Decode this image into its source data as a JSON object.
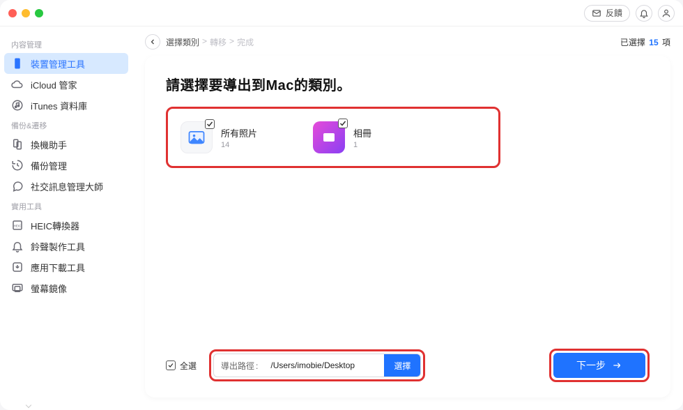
{
  "titlebar": {
    "feedback_label": "反饋"
  },
  "sidebar": {
    "sections": [
      {
        "header": "内容管理",
        "items": [
          {
            "label": "裝置管理工具",
            "icon": "phone-icon",
            "active": true
          },
          {
            "label": "iCloud 管家",
            "icon": "cloud-icon"
          },
          {
            "label": "iTunes 資料庫",
            "icon": "music-note-icon"
          }
        ]
      },
      {
        "header": "備份&遷移",
        "items": [
          {
            "label": "換機助手",
            "icon": "phone-swap-icon"
          },
          {
            "label": "備份管理",
            "icon": "clock-refresh-icon"
          },
          {
            "label": "社交訊息管理大師",
            "icon": "chat-bubble-icon"
          }
        ]
      },
      {
        "header": "實用工具",
        "items": [
          {
            "label": "HEIC轉換器",
            "icon": "heic-icon"
          },
          {
            "label": "鈴聲製作工具",
            "icon": "bell-icon"
          },
          {
            "label": "應用下載工具",
            "icon": "app-download-icon"
          },
          {
            "label": "螢幕鏡像",
            "icon": "screen-mirror-icon"
          }
        ]
      }
    ]
  },
  "breadcrumb": {
    "items": [
      "選擇類別",
      "轉移",
      "完成"
    ],
    "current_index": 0
  },
  "status": {
    "prefix": "已選擇",
    "count": "15",
    "suffix": "項"
  },
  "main": {
    "title": "請選擇要導出到Mac的類別。",
    "categories": [
      {
        "name": "所有照片",
        "count": "14",
        "kind": "photos",
        "checked": true
      },
      {
        "name": "相冊",
        "count": "1",
        "kind": "album",
        "checked": true
      }
    ]
  },
  "footer": {
    "select_all_label": "全選",
    "select_all_checked": true,
    "path_label": "導出路徑",
    "path_value": "/Users/imobie/Desktop",
    "choose_label": "選擇",
    "next_label": "下一步"
  }
}
